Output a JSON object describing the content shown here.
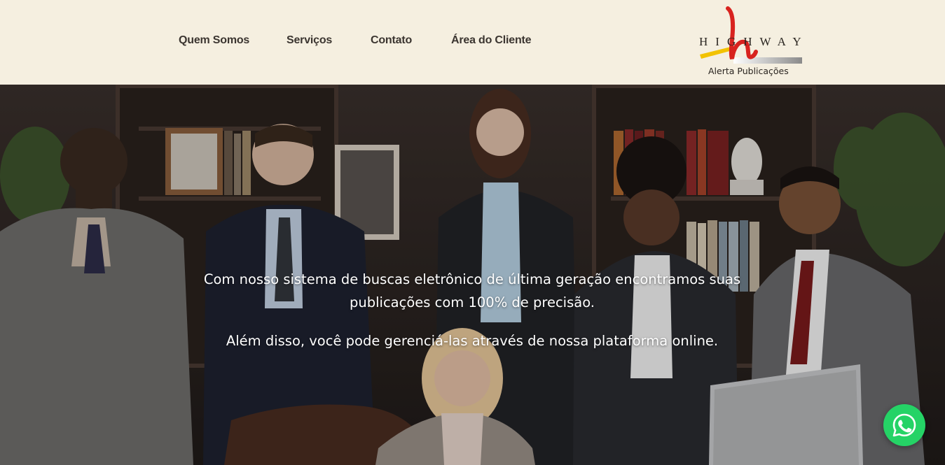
{
  "nav": {
    "items": [
      {
        "label": "Quem Somos"
      },
      {
        "label": "Serviços"
      },
      {
        "label": "Contato"
      },
      {
        "label": "Área do Cliente"
      }
    ]
  },
  "logo": {
    "brand": "HIGHWAY",
    "tagline": "Alerta Publicações",
    "icon": "highway-h-logo",
    "colors": {
      "accent_red": "#d8231f",
      "accent_yellow": "#f2c200"
    }
  },
  "hero": {
    "image": "business-team-photo",
    "line1": "Com nosso sistema de buscas eletrônico de última geração encontramos suas publicações com 100% de precisão.",
    "line2": "Além disso, você pode gerenciá-las através de nossa plataforma online."
  },
  "whatsapp": {
    "icon": "whatsapp-icon",
    "color": "#25d366"
  },
  "theme": {
    "header_bg": "#f5efe0",
    "nav_text": "#3b3530"
  }
}
